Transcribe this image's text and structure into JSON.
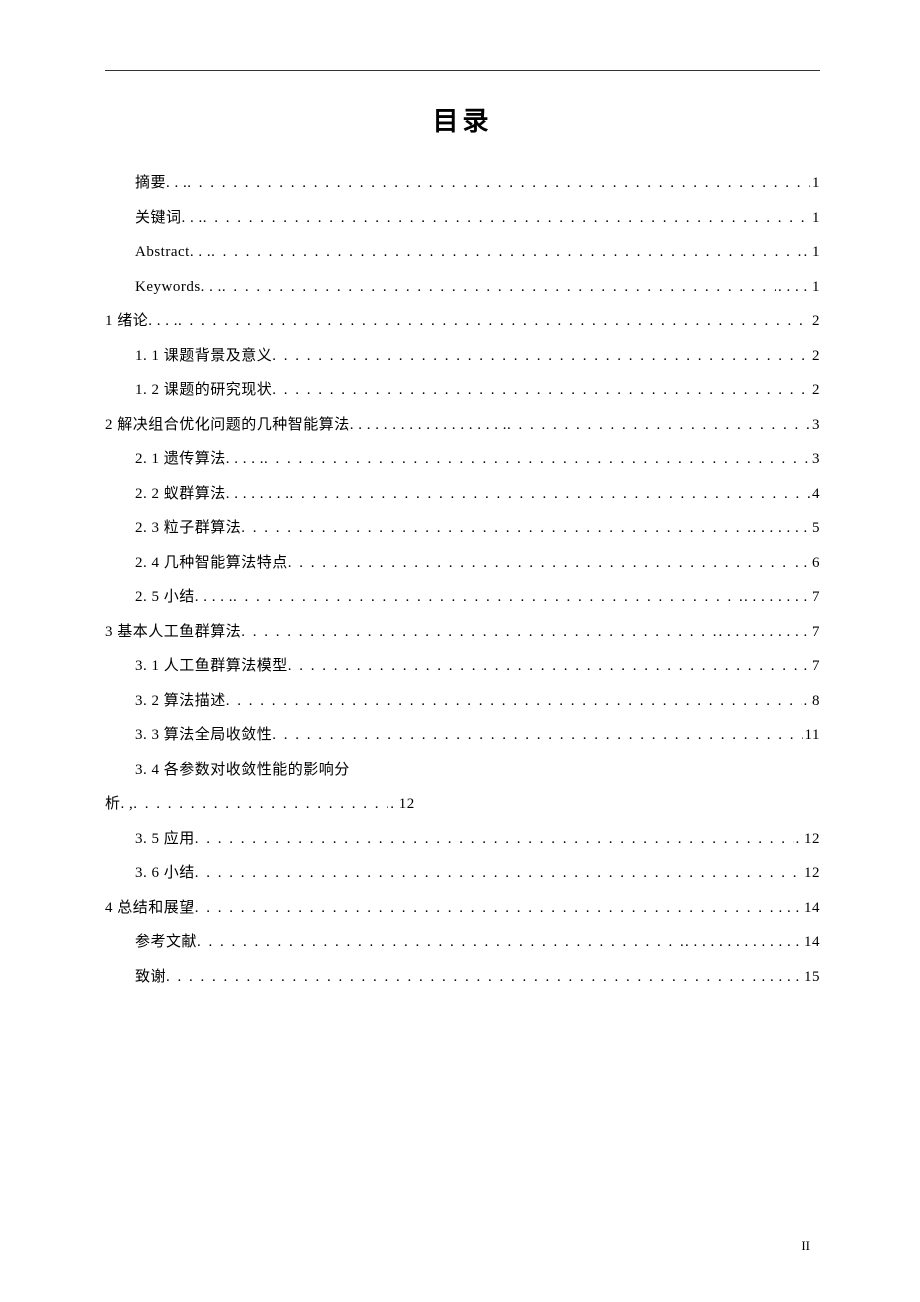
{
  "title": "目录",
  "page_number": "II",
  "dots": ". . . . . . . . . . . . . . . . . . . . . . . . . . . . . . . . . . . . . . . . . . . . . . . . . . . . . . . . . . . . . . . . . . . . . . . . . . . . . . . . . . . . . . . . . . . . . . . . . . . .",
  "entries": [
    {
      "level": 2,
      "label": "摘要. . .",
      "page": "1"
    },
    {
      "level": 2,
      "label": "关键词. . .",
      "page": "1"
    },
    {
      "level": 2,
      "label": "Abstract. . .",
      "page": ". 1"
    },
    {
      "level": 2,
      "label": "Keywords. . .",
      "page": ". . . . 1"
    },
    {
      "level": 1,
      "label": "1 绪论. . . .",
      "page": "2"
    },
    {
      "level": 2,
      "label": "1. 1 课题背景及意义",
      "page": "2"
    },
    {
      "level": 2,
      "label": "1. 2 课题的研究现状",
      "page": " 2"
    },
    {
      "level": 1,
      "label": "2 解决组合优化问题的几种智能算法. . . . . . . . .  . . . . . . .  . . .",
      "page": "3"
    },
    {
      "level": 2,
      "label": "2. 1 遗传算法. . . . .",
      "page": " 3"
    },
    {
      "level": 2,
      "label": "2. 2 蚁群算法. . . . . . . .",
      "page": "4"
    },
    {
      "level": 2,
      "label": "2. 3 粒子群算法",
      "page": ". . . . .  . . 5"
    },
    {
      "level": 2,
      "label": "2. 4 几种智能算法特点",
      "page": " . . 6"
    },
    {
      "level": 2,
      "label": "2. 5 小结. . . . .",
      "page": ". . . . . .  . . 7"
    },
    {
      "level": 1,
      "label": "3 基本人工鱼群算法",
      "page": " . .  . . . . . . . . . 7"
    },
    {
      "level": 2,
      "label": "3. 1 人工鱼群算法模型",
      "page": " . 7"
    },
    {
      "level": 2,
      "label": "3. 2 算法描述",
      "page": " . 8"
    },
    {
      "level": 2,
      "label": "3. 3 算法全局收敛性",
      "page": " 11"
    },
    {
      "level": 2,
      "label": "3. 4 各参数对收敛性能的影响分",
      "page": "",
      "nowrap_only_label": true
    },
    {
      "level": 1,
      "label_wrap": "析. ,",
      "page": " . 12",
      "is_wrap": true
    },
    {
      "level": 2,
      "label": "3. 5 应用",
      "page": " . 12"
    },
    {
      "level": 2,
      "label": "3. 6 小结",
      "page": " 12"
    },
    {
      "level": 1,
      "label": "4 总结和展望",
      "page": " . .  . 14"
    },
    {
      "level": 2,
      "label": "参考文献",
      "page": ". . . . . .  . . . . . .  . . 14"
    },
    {
      "level": 2,
      "label": "致谢",
      "page": " . . . . . 15"
    }
  ]
}
